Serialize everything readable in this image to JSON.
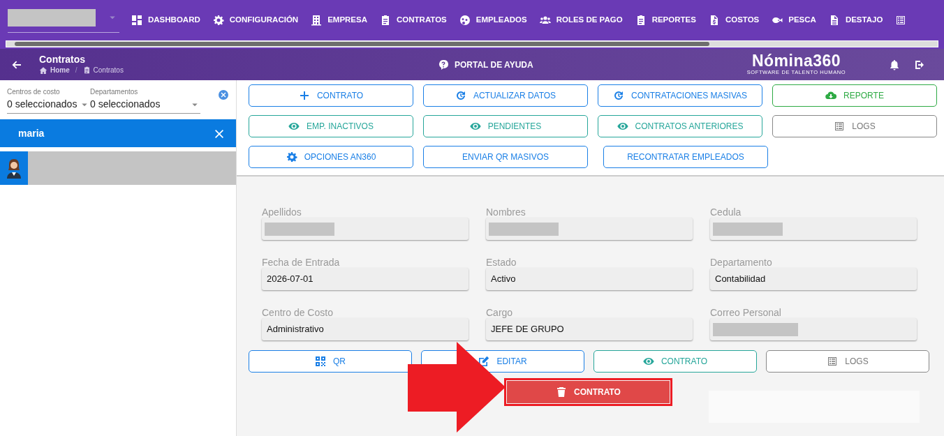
{
  "nav_items": [
    {
      "label": "DASHBOARD"
    },
    {
      "label": "CONFIGURACIÓN"
    },
    {
      "label": "EMPRESA"
    },
    {
      "label": "CONTRATOS"
    },
    {
      "label": "EMPLEADOS"
    },
    {
      "label": "ROLES DE PAGO"
    },
    {
      "label": "REPORTES"
    },
    {
      "label": "COSTOS"
    },
    {
      "label": "PESCA"
    },
    {
      "label": "DESTAJO"
    }
  ],
  "page_header": {
    "title": "Contratos",
    "breadcrumb_separator": "/",
    "breadcrumb": [
      {
        "label": "Home",
        "current": false
      },
      {
        "label": "Contratos",
        "current": true
      }
    ],
    "help_link": "PORTAL DE AYUDA",
    "logo": {
      "name": "Nómina360",
      "tagline": "SOFTWARE DE TALENTO HUMANO"
    }
  },
  "filters": [
    {
      "label": "Centros de costo",
      "value": "0 seleccionados"
    },
    {
      "label": "Departamentos",
      "value": "0 seleccionados"
    }
  ],
  "search": {
    "value": "maria"
  },
  "employees": [
    {
      "selected": true
    }
  ],
  "actions": [
    {
      "label": "CONTRATO",
      "kind": "primary"
    },
    {
      "label": "ACTUALIZAR DATOS",
      "kind": "primary"
    },
    {
      "label": "CONTRATACIONES MASIVAS",
      "kind": "primary"
    },
    {
      "label": "REPORTE",
      "kind": "success"
    },
    {
      "label": "EMP. INACTIVOS",
      "kind": "info"
    },
    {
      "label": "PENDIENTES",
      "kind": "info"
    },
    {
      "label": "CONTRATOS ANTERIORES",
      "kind": "info"
    },
    {
      "label": "LOGS",
      "kind": "secondary"
    },
    {
      "label": "OPCIONES AN360",
      "kind": "primary"
    },
    {
      "label": "ENVIAR QR MASIVOS",
      "kind": "primary"
    },
    {
      "label": "RECONTRATAR EMPLEADOS",
      "kind": "primary"
    }
  ],
  "form_fields": [
    {
      "label": "Apellidos"
    },
    {
      "label": "Nombres"
    },
    {
      "label": "Cedula"
    },
    {
      "label": "Fecha de Entrada",
      "value": "2026-07-01"
    },
    {
      "label": "Estado",
      "value": "Activo"
    },
    {
      "label": "Departamento",
      "value": "Contabilidad"
    },
    {
      "label": "Centro de Costo",
      "value": "Administrativo"
    },
    {
      "label": "Cargo",
      "value": "JEFE DE GRUPO"
    },
    {
      "label": "Correo Personal"
    }
  ],
  "record_actions": [
    {
      "label": "QR",
      "kind": "primary"
    },
    {
      "label": "EDITAR",
      "kind": "primary"
    },
    {
      "label": "CONTRATO",
      "kind": "info"
    },
    {
      "label": "LOGS",
      "kind": "secondary"
    }
  ],
  "delete_button": {
    "label": "CONTRATO",
    "kind": "danger",
    "highlighted": true
  }
}
